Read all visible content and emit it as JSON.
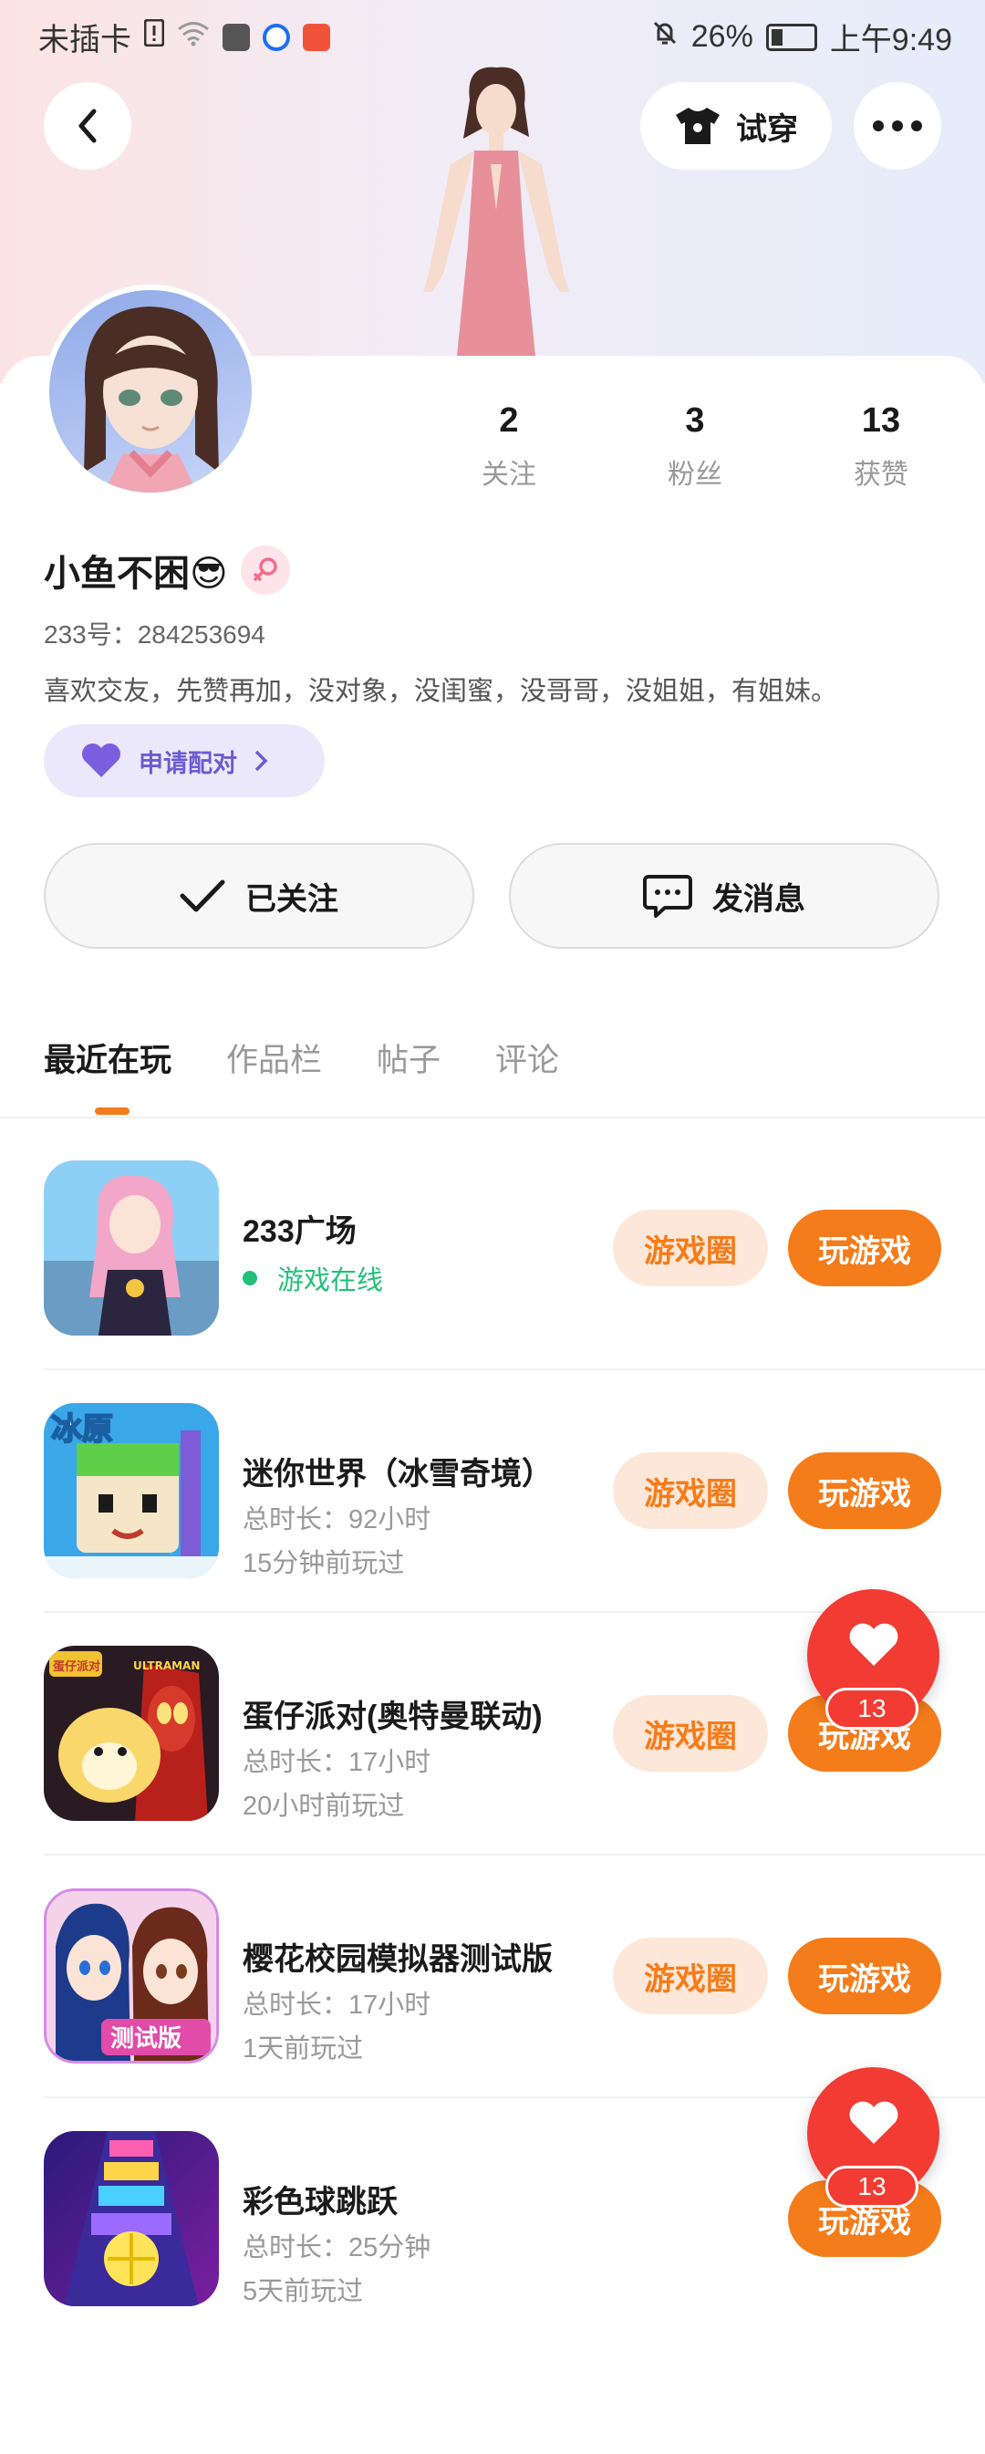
{
  "status_bar": {
    "carrier": "未插卡",
    "battery_percent": "26%",
    "time": "上午9:49"
  },
  "header": {
    "try_on_label": "试穿"
  },
  "profile": {
    "stats": [
      {
        "num": "2",
        "label": "关注"
      },
      {
        "num": "3",
        "label": "粉丝"
      },
      {
        "num": "13",
        "label": "获赞"
      }
    ],
    "name": "小鱼不困😎",
    "uid": "233号：284253694",
    "bio": "喜欢交友，先赞再加，没对象，没闺蜜，没哥哥，没姐姐，有姐妹。",
    "pair_label": "申请配对"
  },
  "actions": {
    "follow_label": "已关注",
    "message_label": "发消息"
  },
  "tabs": [
    "最近在玩",
    "作品栏",
    "帖子",
    "评论"
  ],
  "games": [
    {
      "title": "233广场",
      "status": "游戏在线",
      "circle": "游戏圈",
      "play": "玩游戏"
    },
    {
      "title": "迷你世界（冰雪奇境）",
      "duration": "总时长：92小时",
      "last": "15分钟前玩过",
      "circle": "游戏圈",
      "play": "玩游戏"
    },
    {
      "title": "蛋仔派对(奥特曼联动)",
      "duration": "总时长：17小时",
      "last": "20小时前玩过",
      "circle": "游戏圈",
      "play": "玩游戏"
    },
    {
      "title": "樱花校园模拟器测试版",
      "duration": "总时长：17小时",
      "last": "1天前玩过",
      "circle": "游戏圈",
      "play": "玩游戏"
    },
    {
      "title": "彩色球跳跃",
      "duration": "总时长：25分钟",
      "last": "5天前玩过",
      "circle": "",
      "play": "玩游戏"
    }
  ],
  "icon_texts": {
    "mini_world_badge": "冰原",
    "eggy_badge": "蛋仔派对",
    "eggy_badge_ultraman": "ULTRAMAN",
    "sakura_badge": "测试版"
  },
  "floating_likes": [
    {
      "count": "13"
    },
    {
      "count": "13"
    }
  ],
  "colors": {
    "accent_orange": "#f57c1a",
    "like_red": "#f23b32",
    "online_green": "#22c07a",
    "pair_purple": "#6c5bd0"
  }
}
